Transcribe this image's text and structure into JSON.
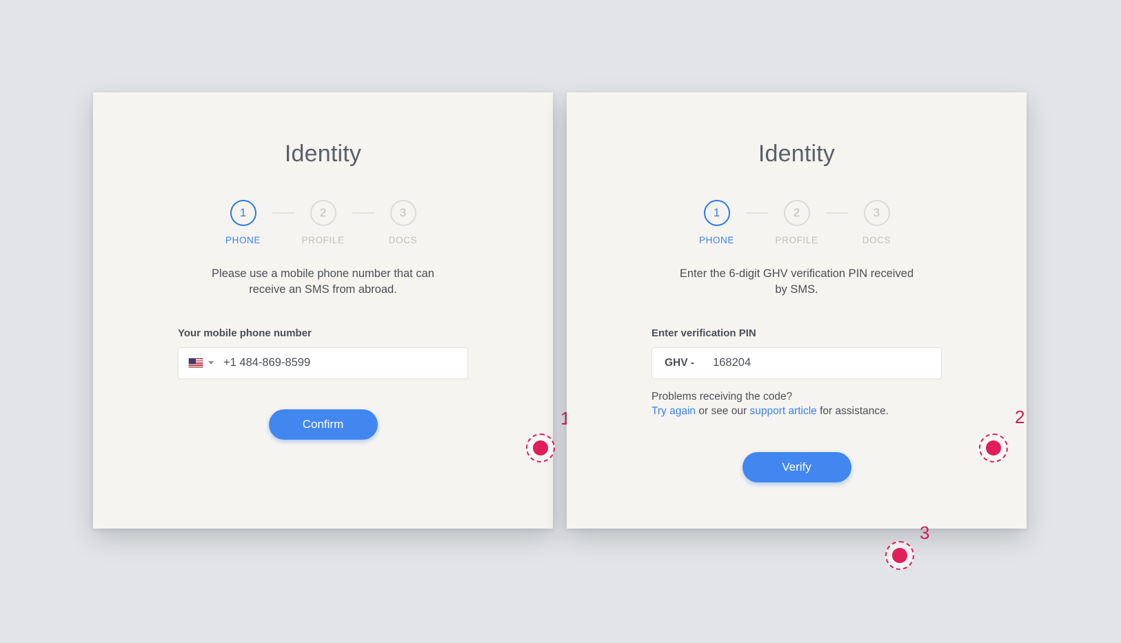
{
  "page": {
    "background_color": "#e2e4e7",
    "card_background": "#f6f4f0",
    "accent_color": "#4287ef",
    "marker_color": "#e01e5a"
  },
  "cards": [
    {
      "id": "phone-step-card",
      "title": "Identity",
      "stepper": [
        {
          "number": "1",
          "label": "PHONE",
          "state": "active"
        },
        {
          "number": "2",
          "label": "PROFILE",
          "state": "inactive"
        },
        {
          "number": "3",
          "label": "DOCS",
          "state": "inactive"
        }
      ],
      "intro": "Please use a mobile phone number that can receive an SMS from abroad.",
      "field": {
        "label": "Your mobile phone number",
        "flag_icon": "us-flag-icon",
        "caret_icon": "chevron-down-icon",
        "value": "+1 484-869-8599",
        "placeholder": "+1 484-869-8599"
      },
      "button": {
        "label": "Confirm"
      }
    },
    {
      "id": "pin-step-card",
      "title": "Identity",
      "stepper": [
        {
          "number": "1",
          "label": "PHONE",
          "state": "active"
        },
        {
          "number": "2",
          "label": "PROFILE",
          "state": "inactive"
        },
        {
          "number": "3",
          "label": "DOCS",
          "state": "inactive"
        }
      ],
      "intro": "Enter the 6-digit GHV verification PIN received by SMS.",
      "field": {
        "label": "Enter verification PIN",
        "prefix": "GHV -",
        "value": "168204",
        "placeholder": "168204"
      },
      "helper": {
        "question": "Problems receiving the code?",
        "link_try_again": "Try again",
        "middle_text": " or see our ",
        "link_support": "support article",
        "tail_text": " for assistance."
      },
      "button": {
        "label": "Verify"
      }
    }
  ],
  "markers": [
    {
      "number": "1",
      "target": "phone-number-input"
    },
    {
      "number": "2",
      "target": "verification-pin-input"
    },
    {
      "number": "3",
      "target": "verify-button"
    }
  ]
}
